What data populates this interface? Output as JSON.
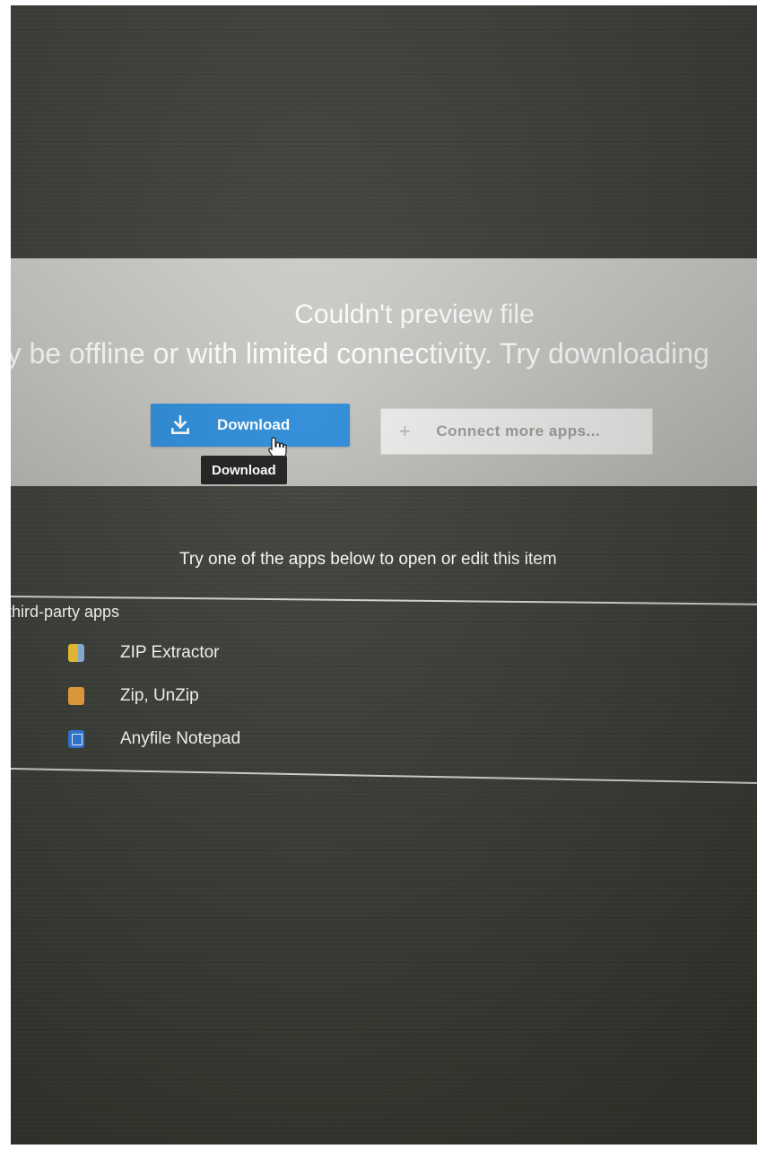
{
  "preview": {
    "title": "Couldn't preview file",
    "message": "nay be offline or with limited connectivity. Try downloading"
  },
  "actions": {
    "download_label": "Download",
    "connect_label": "Connect more apps...",
    "tooltip": "Download"
  },
  "apps": {
    "prompt": "Try one of the apps below to open or edit this item",
    "section_label": "third-party apps",
    "items": [
      {
        "name": "ZIP Extractor",
        "icon": "zip-extractor-icon"
      },
      {
        "name": "Zip, UnZip",
        "icon": "zip-unzip-icon"
      },
      {
        "name": "Anyfile Notepad",
        "icon": "anyfile-notepad-icon"
      }
    ]
  },
  "colors": {
    "download_button": "#2a8ad8",
    "background": "#3a3d36",
    "banner": "#c5c6c2"
  }
}
